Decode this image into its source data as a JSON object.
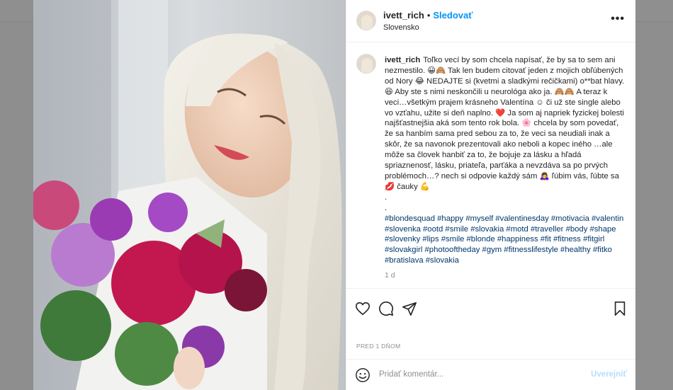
{
  "post": {
    "username": "ivett_rich",
    "follow_label": "Sledovať",
    "location": "Slovensko",
    "more_label": "•••",
    "caption_text": "Toľko vecí by som chcela napísať, že by sa to sem ani nezmestilo. 😀🙈 Tak len budem citovať jeden z mojich obľúbených od Nory 😂 NEDAJTE si (kvetmi a sladkými rečičkami) o**bat hlavy. 😆 Aby ste s nimi neskončili u neurológa ako ja. 🙈🙈 A teraz k veci…všetkým prajem krásneho Valentína ☺ či už ste single alebo vo vzťahu, užite si deň naplno. ❤️ Ja som aj napriek fyzickej bolesti najšťastnejšia aká som tento rok bola. 🌸 chcela by som povedať, že sa hanbím sama pred sebou za to, že veci sa neudiali inak a skôr, že sa navonok prezentovali ako neboli a kopec iného …ale môže sa človek hanbiť za to, že bojuje za lásku a hľadá spriaznenosť, lásku, priateľa, parťáka a nevzdáva sa po prvých problémoch…? nech si odpovie každý sám 🙇‍♀️ ľúbim vás, ľúbte sa 💋 čauky 💪",
    "dot1": ".",
    "dot2": ".",
    "hashtags": "#blondesquad #happy #myself #valentinesday #motivacia #valentin #slovenka #ootd #smile #slovakia #motd #traveller #body #shape #slovenky #lips #smile #blonde #happiness #fit #fitness #fitgirl #slovakgirl #photooftheday #gym #fitnesslifestyle #healthy #fitko #bratislava #slovakia",
    "time_ago": "1 d",
    "date_label": "PRED 1 DŇOM",
    "comment_placeholder": "Pridať komentár...",
    "post_label": "Uverejniť"
  },
  "icons": [
    "like-icon",
    "comment-icon",
    "share-icon",
    "save-icon",
    "emoji-icon",
    "more-options-icon"
  ],
  "colors": {
    "link": "#0095f6",
    "hashtag": "#00376b",
    "muted": "#8e8e8e",
    "text": "#262626",
    "post_disabled": "#b2dffc"
  }
}
